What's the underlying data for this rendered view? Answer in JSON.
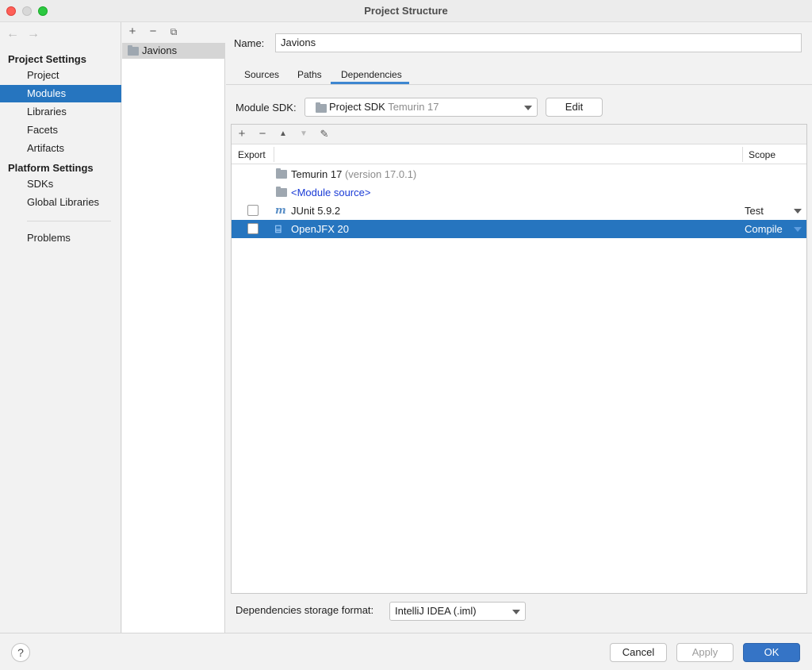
{
  "window": {
    "title": "Project Structure"
  },
  "nav": {
    "project_settings_header": "Project Settings",
    "project_settings_items": [
      "Project",
      "Modules",
      "Libraries",
      "Facets",
      "Artifacts"
    ],
    "platform_settings_header": "Platform Settings",
    "platform_settings_items": [
      "SDKs",
      "Global Libraries"
    ],
    "problems": "Problems",
    "selected": "Modules"
  },
  "modules": {
    "items": [
      "Javions"
    ]
  },
  "module": {
    "name_label": "Name:",
    "name_value": "Javions",
    "tabs": [
      "Sources",
      "Paths",
      "Dependencies"
    ],
    "active_tab": "Dependencies",
    "sdk_label": "Module SDK:",
    "sdk_value": "Project SDK",
    "sdk_detail": "Temurin 17",
    "edit_button": "Edit"
  },
  "dependencies": {
    "header_export": "Export",
    "header_scope": "Scope",
    "rows": [
      {
        "name": "Temurin 17",
        "detail": "(version 17.0.1)",
        "scope": "",
        "checkbox": false
      },
      {
        "name": "<Module source>",
        "detail": "",
        "scope": "",
        "checkbox": false
      },
      {
        "name": "JUnit 5.9.2",
        "detail": "",
        "scope": "Test",
        "checkbox": true
      },
      {
        "name": "OpenJFX 20",
        "detail": "",
        "scope": "Compile",
        "checkbox": true
      }
    ],
    "storage_label": "Dependencies storage format:",
    "storage_value": "IntelliJ IDEA (.iml)"
  },
  "footer": {
    "help": "?",
    "cancel": "Cancel",
    "apply": "Apply",
    "ok": "OK"
  },
  "colors": {
    "selection": "#2675bf",
    "ok_button": "#3574c6",
    "link": "#1a3bd6"
  }
}
